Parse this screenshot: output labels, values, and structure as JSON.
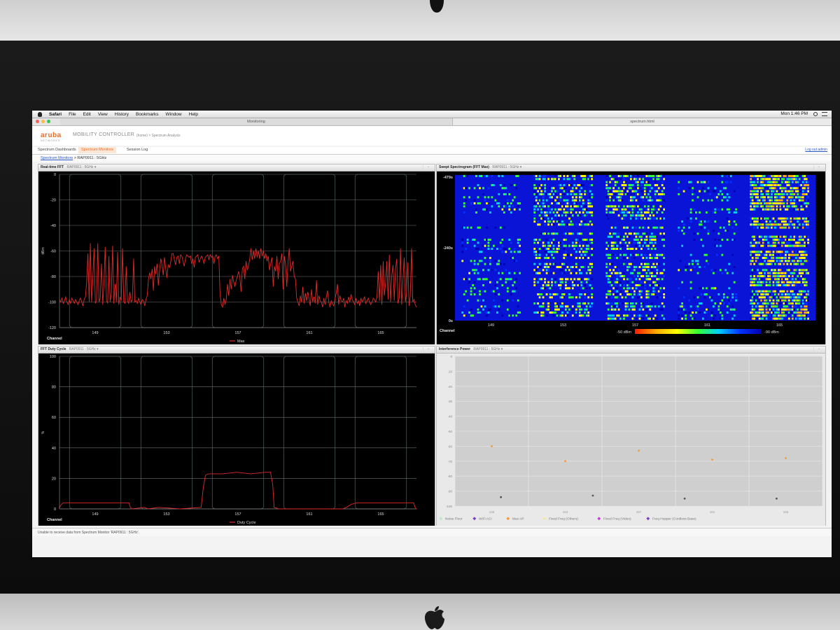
{
  "menubar": {
    "items": [
      "Safari",
      "File",
      "Edit",
      "View",
      "History",
      "Bookmarks",
      "Window",
      "Help"
    ],
    "clock": "Mon 1:46 PM"
  },
  "browser_tabs": [
    "Monitoring",
    "spectrum.html"
  ],
  "app": {
    "brand": "aruba",
    "brand_sub": "NETWORKS",
    "product": "MOBILITY CONTROLLER",
    "top_crumb": "(home) > Spectrum Analysis"
  },
  "nav": {
    "tabs": [
      "Spectrum Dashboards",
      "Spectrum Monitors",
      "Session Log"
    ],
    "active_tab": "Spectrum Monitors",
    "logout": "Log out admin"
  },
  "breadcrumb": {
    "link": "Spectrum Monitors",
    "current": "> RAP0911 : 5GHz"
  },
  "panels": {
    "fft": {
      "title": "Real-time FFT",
      "device": "RAP0911 : 5GHz"
    },
    "spectrogram": {
      "title": "Swept Spectrogram (FFT Max)",
      "device": "RAP0911 : 5GHz"
    },
    "duty": {
      "title": "FFT Duty Cycle",
      "device": "RAP0911 : 5GHz"
    },
    "interference": {
      "title": "Interference Power",
      "device": "RAP0911 : 5GHz"
    }
  },
  "status_message": "Unable to receive data from Spectrum Monitor 'RAP0911 : 5GHz'.",
  "chart_data": [
    {
      "id": "fft",
      "type": "line",
      "ylabel": "dBm",
      "xlabel": "Channel",
      "ylim": [
        -120,
        0
      ],
      "yticks": [
        0,
        -20,
        -40,
        -60,
        -80,
        -100,
        -120
      ],
      "xticks": [
        "149",
        "153",
        "157",
        "161",
        "165"
      ],
      "legend": "Max",
      "grid": true,
      "series": [
        {
          "name": "Max",
          "color": "#e02a2a",
          "values": [
            -98,
            -100,
            -97,
            -101,
            -99,
            -96,
            -100,
            -102,
            -98,
            -101,
            -97,
            -99,
            -101,
            -98,
            -100,
            -102,
            -99,
            -97,
            -100,
            -103,
            -98,
            -96,
            -84,
            -62,
            -100,
            -54,
            -100,
            -83,
            -58,
            -101,
            -99,
            -54,
            -100,
            -97,
            -70,
            -102,
            -85,
            -57,
            -99,
            -101,
            -64,
            -100,
            -93,
            -56,
            -101,
            -86,
            -100,
            -61,
            -102,
            -96,
            -99,
            -58,
            -100,
            -101,
            -72,
            -99,
            -101,
            -92,
            -100,
            -98,
            -66,
            -100,
            -99,
            -101,
            -97,
            -100,
            -102,
            -98,
            -99,
            -103,
            -98,
            -95,
            -82,
            -77,
            -82,
            -74,
            -91,
            -72,
            -78,
            -70,
            -87,
            -76,
            -66,
            -71,
            -79,
            -65,
            -74,
            -81,
            -71,
            -73,
            -69,
            -62,
            -62,
            -67,
            -71,
            -65,
            -64,
            -70,
            -63,
            -64,
            -68,
            -72,
            -66,
            -63,
            -64,
            -65,
            -64,
            -70,
            -66,
            -73,
            -65,
            -64,
            -63,
            -69,
            -66,
            -64,
            -66,
            -70,
            -65,
            -64,
            -63,
            -67,
            -63,
            -65,
            -64,
            -70,
            -64,
            -63,
            -66,
            -64,
            -94,
            -102,
            -104,
            -97,
            -102,
            -98,
            -86,
            -95,
            -82,
            -90,
            -79,
            -84,
            -88,
            -83,
            -80,
            -76,
            -80,
            -92,
            -74,
            -72,
            -82,
            -68,
            -75,
            -72,
            -66,
            -58,
            -67,
            -60,
            -66,
            -58,
            -65,
            -60,
            -66,
            -58,
            -64,
            -60,
            -66,
            -62,
            -68,
            -64,
            -75,
            -70,
            -65,
            -88,
            -72,
            -76,
            -64,
            -82,
            -70,
            -68,
            -62,
            -90,
            -64,
            -70,
            -88,
            -69,
            -58,
            -76,
            -72,
            -68,
            -80,
            -82,
            -97,
            -100,
            -103,
            -95,
            -100,
            -88,
            -101,
            -93,
            -99,
            -92,
            -97,
            -103,
            -90,
            -100,
            -96,
            -101,
            -83,
            -102,
            -95,
            -99,
            -100,
            -104,
            -97,
            -102,
            -96,
            -91,
            -100,
            -104,
            -99,
            -101,
            -103,
            -98,
            -93,
            -86,
            -102,
            -95,
            -99,
            -100,
            -97,
            -104,
            -99,
            -101,
            -96,
            -100,
            -94,
            -98,
            -100,
            -102,
            -97,
            -101,
            -99,
            -103,
            -97,
            -100,
            -98,
            -96,
            -101,
            -99,
            -97,
            -100,
            -102,
            -100,
            -97,
            -98,
            -100,
            -96,
            -76,
            -99,
            -71,
            -102,
            -68,
            -95,
            -85,
            -68,
            -98,
            -63,
            -100,
            -79,
            -71,
            -99,
            -74,
            -66,
            -101,
            -97,
            -58,
            -102,
            -84,
            -65,
            -100,
            -92,
            -69,
            -103,
            -95,
            -58,
            -100,
            -98,
            -102,
            -104
          ]
        }
      ]
    },
    {
      "id": "spectrogram",
      "type": "heatmap",
      "xlabel": "Channel",
      "xticks": [
        "149",
        "153",
        "157",
        "161",
        "165"
      ],
      "yticks": [
        "-479s",
        "-240s",
        "0s"
      ],
      "scale_labels": [
        "-50 dBm",
        "-90 dBm"
      ],
      "scale_colors": [
        "#ff1a00",
        "#ffaa00",
        "#ffff00",
        "#33ff33",
        "#00d0ff",
        "#0033ff",
        "#0000b0"
      ],
      "channel_activity": [
        {
          "channel": "149",
          "level": "moderate"
        },
        {
          "channel": "153",
          "level": "high"
        },
        {
          "channel": "157",
          "level": "high"
        },
        {
          "channel": "161",
          "level": "moderate"
        },
        {
          "channel": "165",
          "level": "very high"
        }
      ]
    },
    {
      "id": "duty",
      "type": "line",
      "ylabel": "%",
      "xlabel": "Channel",
      "ylim": [
        0,
        100
      ],
      "yticks": [
        100,
        80,
        60,
        40,
        20,
        0
      ],
      "xticks": [
        "149",
        "153",
        "157",
        "161",
        "165"
      ],
      "legend": "Duty Cycle",
      "grid": true,
      "series": [
        {
          "name": "Duty Cycle",
          "color": "#e02a2a",
          "points": [
            [
              0,
              0
            ],
            [
              1,
              2
            ],
            [
              3,
              3
            ],
            [
              5,
              4
            ],
            [
              10,
              4
            ],
            [
              30,
              4
            ],
            [
              50,
              4
            ],
            [
              70,
              4
            ],
            [
              90,
              4
            ],
            [
              98,
              4
            ],
            [
              100,
              1
            ],
            [
              102,
              0
            ],
            [
              120,
              1
            ],
            [
              125,
              0
            ],
            [
              140,
              1
            ],
            [
              170,
              0
            ],
            [
              200,
              1
            ],
            [
              203,
              14
            ],
            [
              206,
              22
            ],
            [
              210,
              23
            ],
            [
              230,
              23
            ],
            [
              250,
              24
            ],
            [
              270,
              23
            ],
            [
              290,
              24
            ],
            [
              298,
              24
            ],
            [
              301,
              16
            ],
            [
              303,
              1
            ],
            [
              310,
              0
            ],
            [
              340,
              0
            ],
            [
              400,
              0
            ],
            [
              405,
              1
            ],
            [
              412,
              3
            ],
            [
              420,
              4
            ],
            [
              440,
              4
            ],
            [
              460,
              4
            ],
            [
              480,
              4
            ],
            [
              500,
              4
            ],
            [
              502,
              1
            ],
            [
              504,
              0
            ]
          ]
        }
      ]
    },
    {
      "id": "interference",
      "type": "scatter",
      "xlabel": "",
      "ylim": [
        -100,
        0
      ],
      "yticks": [
        0,
        -10,
        -20,
        -30,
        -40,
        -50,
        -60,
        -70,
        -80,
        -90,
        -100
      ],
      "xticks": [
        "149",
        "153",
        "157",
        "161",
        "165"
      ],
      "grid": true,
      "legend": [
        "Noise Floor",
        "WiFi ACI",
        "Max AP",
        "Fixed Freq (Others)",
        "Fixed Freq (Video)",
        "Freq Hopper (Cordless Base)"
      ],
      "legend_colors": [
        "#bde6c8",
        "#7a3fbf",
        "#f59a3a",
        "#f3e8a0",
        "#c43fd1",
        "#7a3fbf"
      ],
      "series": [
        {
          "name": "Noise Floor",
          "color": "#555555",
          "values": [
            -94,
            -93,
            -95,
            -95
          ]
        },
        {
          "name": "Max AP",
          "color": "#f59a3a",
          "values": [
            -60,
            -70,
            -63,
            -69,
            -68
          ]
        }
      ]
    }
  ]
}
